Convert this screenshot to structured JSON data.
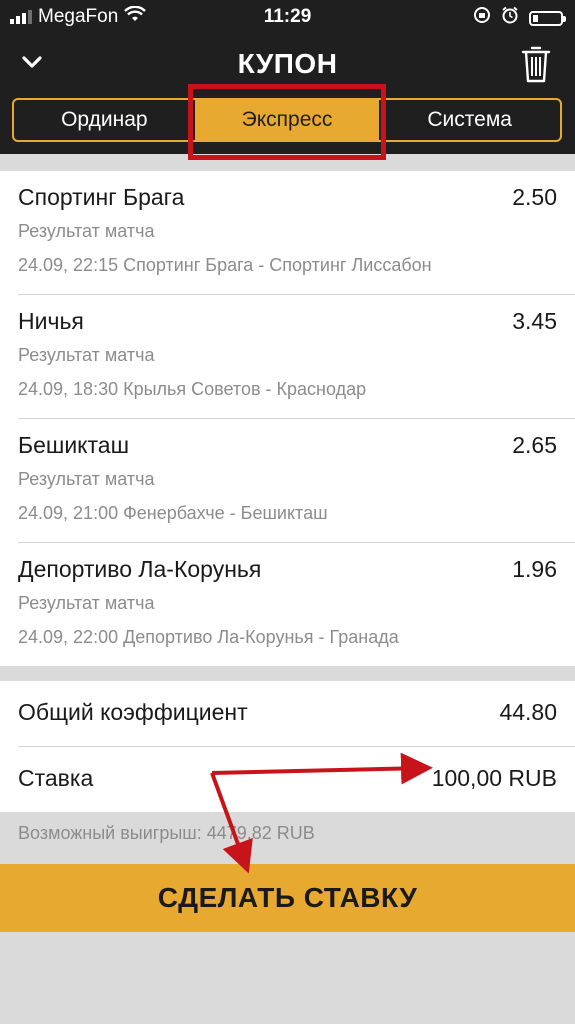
{
  "status": {
    "carrier": "MegaFon",
    "time": "11:29"
  },
  "header": {
    "title": "КУПОН"
  },
  "tabs": [
    {
      "label": "Ординар",
      "active": false
    },
    {
      "label": "Экспресс",
      "active": true
    },
    {
      "label": "Система",
      "active": false
    }
  ],
  "bets": [
    {
      "selection": "Спортинг Брага",
      "odds": "2.50",
      "market": "Результат матча",
      "event": "24.09, 22:15 Спортинг Брага - Спортинг Лиссабон"
    },
    {
      "selection": "Ничья",
      "odds": "3.45",
      "market": "Результат матча",
      "event": "24.09, 18:30 Крылья Советов - Краснодар"
    },
    {
      "selection": "Бешикташ",
      "odds": "2.65",
      "market": "Результат матча",
      "event": "24.09, 21:00 Фенербахче - Бешикташ"
    },
    {
      "selection": "Депортиво Ла-Корунья",
      "odds": "1.96",
      "market": "Результат матча",
      "event": "24.09, 22:00 Депортиво Ла-Корунья - Гранада"
    }
  ],
  "summary": {
    "total_odds_label": "Общий коэффициент",
    "total_odds": "44.80",
    "stake_label": "Ставка",
    "stake": "100,00 RUB"
  },
  "winnings": "Возможный выигрыш: 4479,82 RUB",
  "cta": {
    "label": "СДЕЛАТЬ СТАВКУ"
  },
  "colors": {
    "accent": "#e8a931",
    "header_bg": "#1f1f1f",
    "annotation_red": "#c7141a"
  },
  "icons": {
    "back": "chevron-down-icon",
    "delete": "trash-icon"
  }
}
